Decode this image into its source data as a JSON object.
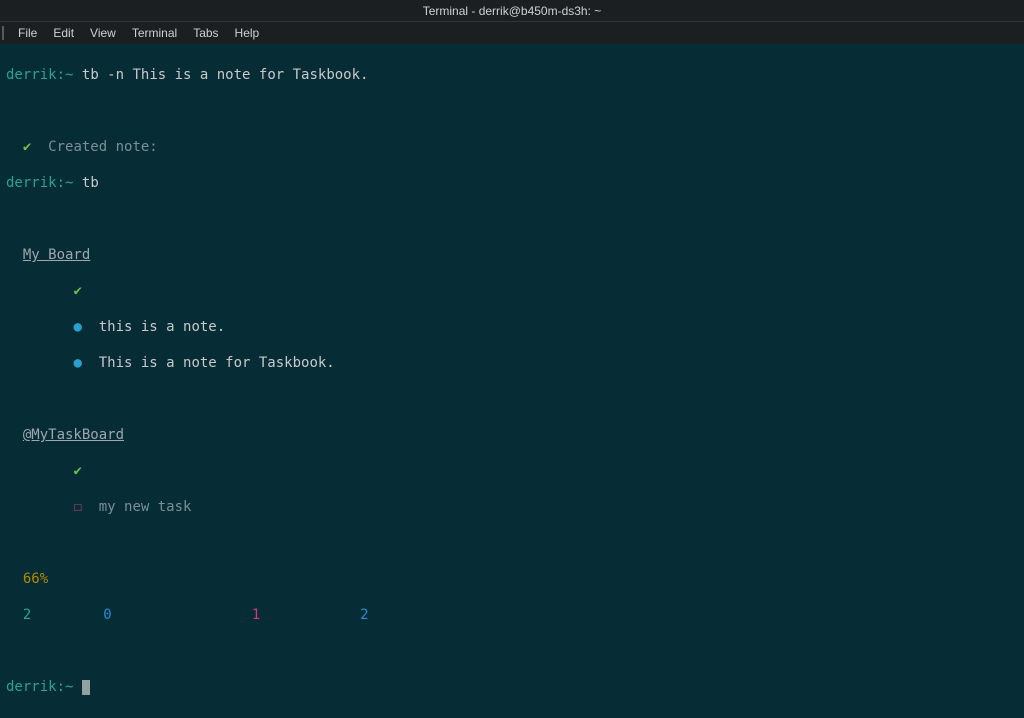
{
  "titlebar": {
    "text": "Terminal - derrik@b450m-ds3h: ~"
  },
  "menu": {
    "file": "File",
    "edit": "Edit",
    "view": "View",
    "terminal": "Terminal",
    "tabs": "Tabs",
    "help": "Help"
  },
  "prompt": {
    "user": "derrik",
    "sep": ":",
    "path": "~",
    "sigil": "$ "
  },
  "lines": {
    "cmd1": "tb -n This is a note for Taskbook.",
    "created_check": "✔",
    "created_text": "Created note:",
    "cmd2": "tb",
    "board1_title": "My Board",
    "board1_check": "✔",
    "board1_item1_bullet": "●",
    "board1_item1_text": "this is a note.",
    "board1_item2_bullet": "●",
    "board1_item2_text": "This is a note for Taskbook.",
    "board2_title": "@MyTaskBoard",
    "board2_check": "✔",
    "board2_item1_box": "☐",
    "board2_item1_text": "my new task",
    "percent": "66%",
    "stat1": "2",
    "stat2": "0",
    "stat3": "1",
    "stat4": "2"
  }
}
